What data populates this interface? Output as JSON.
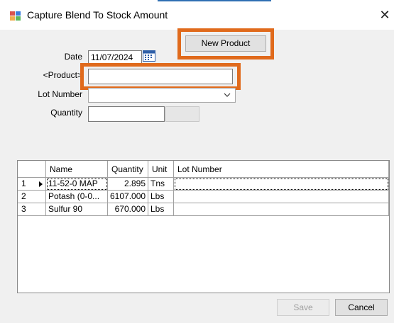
{
  "window": {
    "title": "Capture Blend To Stock Amount"
  },
  "form": {
    "date_label": "Date",
    "date_value": "11/07/2024",
    "product_label": "<Product>",
    "product_value": "",
    "lot_label": "Lot Number",
    "lot_value": "",
    "quantity_label": "Quantity",
    "quantity_value": ""
  },
  "buttons": {
    "new_product": "New Product",
    "save": "Save",
    "cancel": "Cancel"
  },
  "grid": {
    "columns": [
      "Name",
      "Quantity",
      "Unit",
      "Lot Number"
    ],
    "rows": [
      {
        "row": "1",
        "name": "11-52-0 MAP",
        "quantity": "2.895",
        "unit": "Tns",
        "lot": ""
      },
      {
        "row": "2",
        "name": "Potash (0-0...",
        "quantity": "6107.000",
        "unit": "Lbs",
        "lot": ""
      },
      {
        "row": "3",
        "name": "Sulfur 90",
        "quantity": "670.000",
        "unit": "Lbs",
        "lot": ""
      }
    ]
  },
  "colors": {
    "highlight": "#e06a1c"
  }
}
